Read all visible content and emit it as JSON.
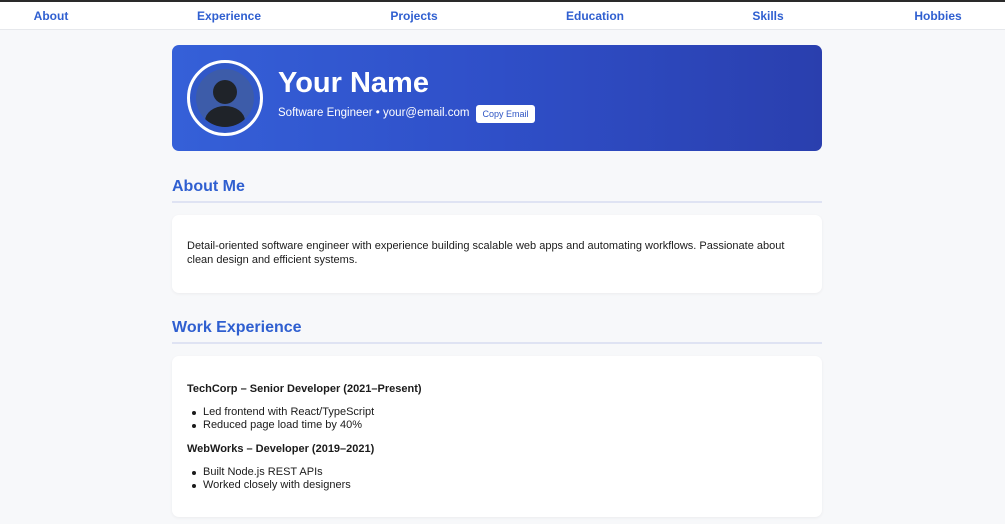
{
  "nav": {
    "items": [
      {
        "label": "About"
      },
      {
        "label": "Experience"
      },
      {
        "label": "Projects"
      },
      {
        "label": "Education"
      },
      {
        "label": "Skills"
      },
      {
        "label": "Hobbies"
      }
    ]
  },
  "hero": {
    "name": "Your Name",
    "subtitle": "Software Engineer • your@email.com",
    "copy_button": "Copy Email",
    "avatar_icon": "user-avatar-icon"
  },
  "about": {
    "title": "About Me",
    "text": "Detail-oriented software engineer with experience building scalable web apps and automating workflows. Passionate about clean design and efficient systems."
  },
  "experience": {
    "title": "Work Experience",
    "jobs": [
      {
        "title": "TechCorp – Senior Developer (2021–Present)",
        "bullets": [
          "Led frontend with React/TypeScript",
          "Reduced page load time by 40%"
        ]
      },
      {
        "title": "WebWorks – Developer (2019–2021)",
        "bullets": [
          "Built Node.js REST APIs",
          "Worked closely with designers"
        ]
      }
    ]
  },
  "colors": {
    "accent": "#2f5fd0",
    "hero_gradient_start": "#3560d8",
    "hero_gradient_end": "#2a3fae",
    "background": "#f7f8fa"
  }
}
